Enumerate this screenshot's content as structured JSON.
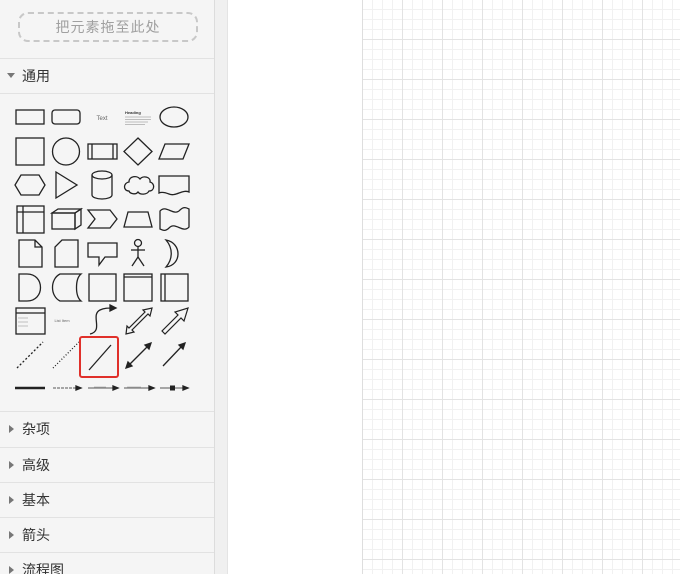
{
  "sidebar": {
    "dropzone_label": "把元素拖至此处",
    "sections": [
      {
        "label": "通用",
        "expanded": true
      },
      {
        "label": "杂项",
        "expanded": false
      },
      {
        "label": "高级",
        "expanded": false
      },
      {
        "label": "基本",
        "expanded": false
      },
      {
        "label": "箭头",
        "expanded": false
      },
      {
        "label": "流程图",
        "expanded": false
      }
    ],
    "shape_text": {
      "text": "Text",
      "heading": "Heading",
      "list_item": "List Item"
    }
  },
  "colors": {
    "selection": "#e0302a",
    "grid_major": "#e3e3e3",
    "grid_minor": "#f1f1f1"
  }
}
